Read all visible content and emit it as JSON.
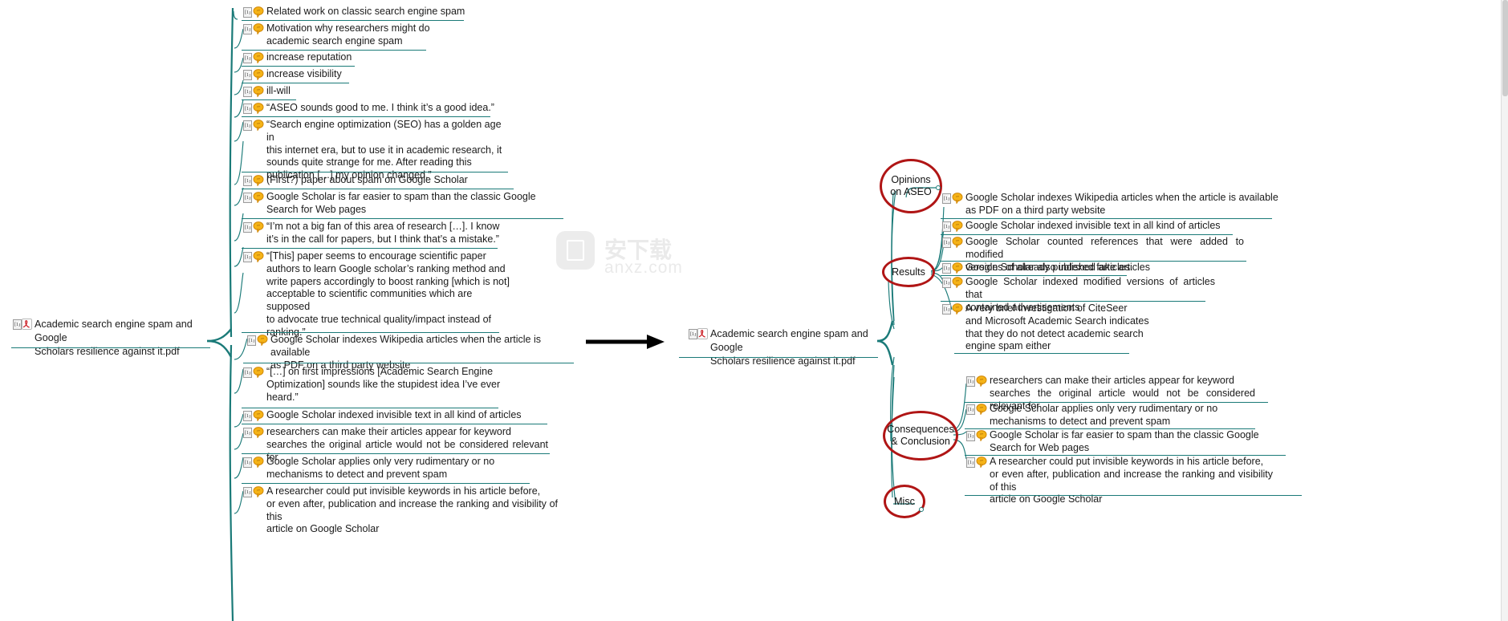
{
  "app": {
    "type": "mind-map",
    "colors": {
      "branch": "#1a7a78",
      "category_ellipse": "#b01515",
      "text": "#1a1a1a",
      "background": "#ffffff",
      "arrow": "#000000"
    }
  },
  "watermark": {
    "brand_cn": "安下载",
    "brand_url": "anxz.com"
  },
  "left_map": {
    "root": {
      "label": "Academic search engine spam and Google\nScholars resilience against it.pdf",
      "icons": [
        "pdf-page-icon",
        "adobe-pdf-icon"
      ]
    },
    "children": [
      {
        "id": "l1",
        "label": "Related work on classic search engine spam",
        "icons": [
          "pdf-page-icon",
          "comment-bubble-icon"
        ]
      },
      {
        "id": "l2",
        "label": "Motivation why researchers might do\nacademic search engine spam",
        "icons": [
          "pdf-page-icon",
          "comment-bubble-icon"
        ]
      },
      {
        "id": "l3",
        "label": "increase reputation",
        "icons": [
          "pdf-page-icon",
          "comment-bubble-icon"
        ]
      },
      {
        "id": "l4",
        "label": "increase visibility",
        "icons": [
          "pdf-page-icon",
          "comment-bubble-icon"
        ]
      },
      {
        "id": "l5",
        "label": "ill-will",
        "icons": [
          "pdf-page-icon",
          "comment-bubble-icon"
        ]
      },
      {
        "id": "l6",
        "label": "“ASEO sounds good to me. I think it’s a good idea.”",
        "icons": [
          "pdf-page-icon",
          "comment-bubble-icon"
        ]
      },
      {
        "id": "l7",
        "label": "“Search engine optimization (SEO) has a golden age in\nthis internet era, but to use it in academic research, it\nsounds quite strange for me. After reading this\npublication […] my opinion changed.”",
        "icons": [
          "pdf-page-icon",
          "comment-bubble-icon"
        ]
      },
      {
        "id": "l8",
        "label": "(First?) paper about spam on Google Scholar",
        "icons": [
          "pdf-page-icon",
          "comment-bubble-icon"
        ]
      },
      {
        "id": "l9",
        "label": "Google  Scholar  is  far  easier  to  spam  than  the  classic  Google\nSearch for  Web pages",
        "icons": [
          "pdf-page-icon",
          "comment-bubble-icon"
        ]
      },
      {
        "id": "l10",
        "label": "“I’m not a big fan of this area of research […]. I know\nit’s in the call for papers, but I think that’s a mistake.”",
        "icons": [
          "pdf-page-icon",
          "comment-bubble-icon"
        ]
      },
      {
        "id": "l11",
        "label": "“[This] paper seems to encourage scientific paper\nauthors to learn Google scholar’s ranking method and\nwrite papers accordingly to boost ranking [which is not]\nacceptable to scientific communities which are supposed\nto advocate true technical quality/impact instead of\nranking.”",
        "icons": [
          "pdf-page-icon",
          "comment-bubble-icon"
        ]
      },
      {
        "id": "l12",
        "label": "Google Scholar indexes Wikipedia articles when the article is available\nas PDF on a third party website",
        "icons": [
          "pdf-page-icon",
          "comment-bubble-icon"
        ]
      },
      {
        "id": "l13",
        "label": "“[…] on first impressions [Academic Search Engine\nOptimization] sounds like the stupidest idea I’ve ever\nheard.”",
        "icons": [
          "pdf-page-icon",
          "comment-bubble-icon"
        ]
      },
      {
        "id": "l14",
        "label": "Google  Scholar  indexed  invisible  text  in  all  kind  of  articles",
        "icons": [
          "pdf-page-icon",
          "comment-bubble-icon"
        ]
      },
      {
        "id": "l15",
        "label": "researchers  can  make  their  articles  appear  for  keyword\nsearches the original article would not be considered relevant for",
        "icons": [
          "pdf-page-icon",
          "comment-bubble-icon"
        ]
      },
      {
        "id": "l16",
        "label": " Google  Scholar  applies  only  very  rudimentary  or  no\nmechanisms to detect and prevent spam",
        "icons": [
          "pdf-page-icon",
          "comment-bubble-icon"
        ]
      },
      {
        "id": "l17",
        "label": "A researcher  could  put  invisible  keywords  in his  article  before,\nor even after, publication and increase the ranking and visibility of this\narticle on Google Scholar",
        "icons": [
          "pdf-page-icon",
          "comment-bubble-icon"
        ]
      }
    ]
  },
  "right_map": {
    "root": {
      "label": "Academic search engine spam and Google\nScholars resilience against it.pdf",
      "icons": [
        "pdf-page-icon",
        "adobe-pdf-icon"
      ]
    },
    "categories": [
      {
        "id": "opinions",
        "label": "Opinions\non ASEO"
      },
      {
        "id": "results",
        "label": "Results"
      },
      {
        "id": "consequences",
        "label": "Consequences\n& Conclusion"
      },
      {
        "id": "misc",
        "label": "Misc"
      }
    ],
    "results_children": [
      {
        "id": "r1",
        "label": "Google Scholar indexes Wikipedia articles when the article is available\nas PDF on a third party website",
        "icons": [
          "pdf-page-icon",
          "comment-bubble-icon"
        ]
      },
      {
        "id": "r2",
        "label": "Google  Scholar  indexed  invisible  text  in  all  kind  of  articles",
        "icons": [
          "pdf-page-icon",
          "comment-bubble-icon"
        ]
      },
      {
        "id": "r3",
        "label": "Google  Scholar  counted  references  that  were  added  to  modified\nversions of  already  published  articles.",
        "icons": [
          "pdf-page-icon",
          "comment-bubble-icon"
        ]
      },
      {
        "id": "r4",
        "label": "Google Scholar also  indexed fake articles",
        "icons": [
          "pdf-page-icon",
          "comment-bubble-icon"
        ]
      },
      {
        "id": "r5",
        "label": "Google  Scholar  indexed  modified  versions  of  articles  that\ncontained   advertisements",
        "icons": [
          "pdf-page-icon",
          "comment-bubble-icon"
        ]
      },
      {
        "id": "r6",
        "label": "A very brief investigation of CiteSeer\nand Microsoft Academic Search indicates\nthat they do not detect academic search\nengine spam either",
        "icons": [
          "pdf-page-icon",
          "comment-bubble-icon"
        ]
      }
    ],
    "consequences_children": [
      {
        "id": "c1",
        "label": "researchers  can  make  their  articles  appear  for  keyword\nsearches the original article would not be considered relevant for",
        "icons": [
          "pdf-page-icon",
          "comment-bubble-icon"
        ]
      },
      {
        "id": "c2",
        "label": " Google  Scholar  applies  only  very  rudimentary  or  no\nmechanisms to detect and prevent spam",
        "icons": [
          "pdf-page-icon",
          "comment-bubble-icon"
        ]
      },
      {
        "id": "c3",
        "label": "Google  Scholar  is  far  easier  to  spam  than  the  classic  Google\nSearch for  Web pages",
        "icons": [
          "pdf-page-icon",
          "comment-bubble-icon"
        ]
      },
      {
        "id": "c4",
        "label": "A researcher  could  put  invisible  keywords  in his  article  before,\nor even after, publication and increase the ranking and visibility of this\narticle on Google Scholar",
        "icons": [
          "pdf-page-icon",
          "comment-bubble-icon"
        ]
      }
    ]
  }
}
